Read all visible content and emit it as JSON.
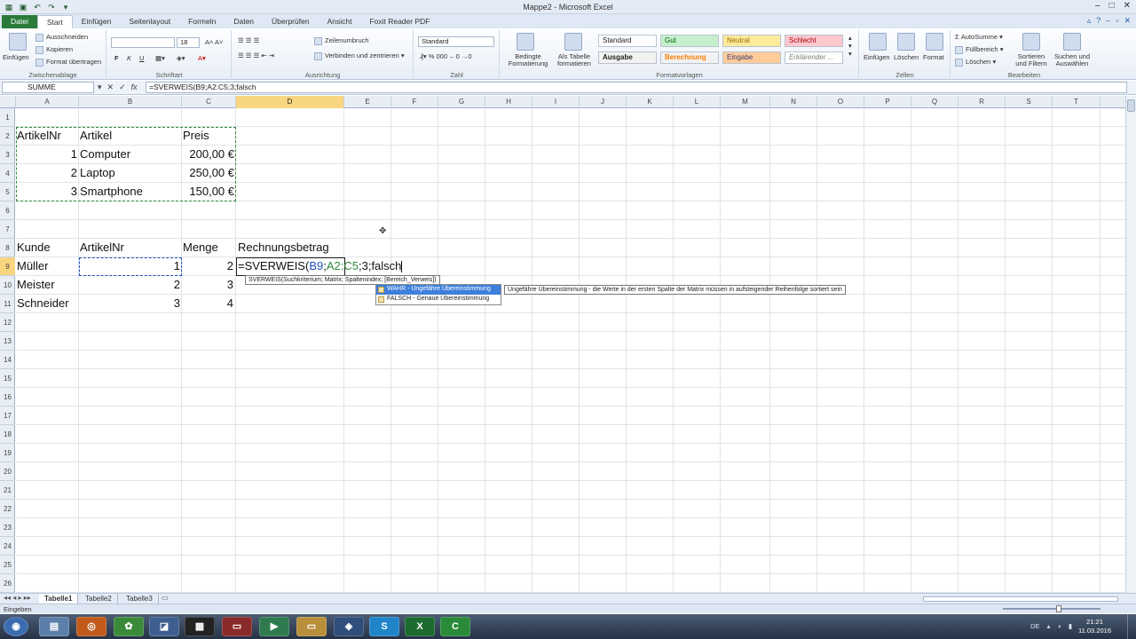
{
  "window": {
    "title": "Mappe2 - Microsoft Excel"
  },
  "tabs": [
    "Datei",
    "Start",
    "Einfügen",
    "Seitenlayout",
    "Formeln",
    "Daten",
    "Überprüfen",
    "Ansicht",
    "Foxit Reader PDF"
  ],
  "ribbon": {
    "clipboard": {
      "paste": "Einfügen",
      "cut": "Ausschneiden",
      "copy": "Kopieren",
      "format_painter": "Format übertragen",
      "title": "Zwischenablage"
    },
    "font": {
      "size": "18",
      "title": "Schriftart",
      "bold": "F",
      "italic": "K",
      "underline": "U"
    },
    "alignment": {
      "wrap": "Zeilenumbruch",
      "merge": "Verbinden und zentrieren",
      "title": "Ausrichtung"
    },
    "number": {
      "format": "Standard",
      "title": "Zahl"
    },
    "styles": {
      "cond_format": "Bedingte Formatierung",
      "as_table": "Als Tabelle formatieren",
      "boxes": [
        "Standard",
        "Gut",
        "Neutral",
        "Schlecht",
        "Ausgabe",
        "Berechnung",
        "Eingabe",
        "Erklärender ..."
      ],
      "title": "Formatvorlagen"
    },
    "cells": {
      "insert": "Einfügen",
      "delete": "Löschen",
      "format": "Format",
      "title": "Zellen"
    },
    "editing": {
      "autosum": "AutoSumme",
      "fill": "Füllbereich",
      "clear": "Löschen",
      "sort": "Sortieren und Filtern",
      "find": "Suchen und Auswählen",
      "title": "Bearbeiten"
    }
  },
  "formula_bar": {
    "name_box": "SUMME",
    "formula": "=SVERWEIS(B9;A2:C5;3;falsch"
  },
  "columns": [
    "A",
    "B",
    "C",
    "D",
    "E",
    "F",
    "G",
    "H",
    "I",
    "J",
    "K",
    "L",
    "M",
    "N",
    "O",
    "P",
    "Q",
    "R",
    "S",
    "T"
  ],
  "rows": [
    "1",
    "2",
    "3",
    "4",
    "5",
    "6",
    "7",
    "8",
    "9",
    "10",
    "11",
    "12",
    "13",
    "14",
    "15",
    "16",
    "17",
    "18",
    "19",
    "20",
    "21",
    "22",
    "23",
    "24",
    "25",
    "26"
  ],
  "cells": {
    "a2": "ArtikelNr",
    "b2": "Artikel",
    "c2": "Preis",
    "a3": "1",
    "b3": "Computer",
    "c3": "200,00 €",
    "a4": "2",
    "b4": "Laptop",
    "c4": "250,00 €",
    "a5": "3",
    "b5": "Smartphone",
    "c5": "150,00 €",
    "a8": "Kunde",
    "b8": "ArtikelNr",
    "c8": "Menge",
    "d8": "Rechnungsbetrag",
    "a9": "Müller",
    "b9": "1",
    "c9": "2",
    "a10": "Meister",
    "b10": "2",
    "c10": "3",
    "a11": "Schneider",
    "b11": "3",
    "c11": "4",
    "d9_prefix": "=SVERWEIS(",
    "d9_ref1": "B9",
    "d9_sep1": ";",
    "d9_ref2": "A2:C5",
    "d9_rest": ";3;falsch"
  },
  "autocomplete": {
    "syntax_tip": "SVERWEIS(Suchkriterium; Matrix; Spaltenindex; [Bereich_Verweis])",
    "items": [
      "WAHR - Ungefähre Übereinstimmung",
      "FALSCH - Genaue Übereinstimmung"
    ],
    "description": "Ungefähre Übereinstimmung - die Werte in der ersten Spalte der Matrix müssen in aufsteigender Reihenfolge sortiert sein"
  },
  "sheets": [
    "Tabelle1",
    "Tabelle2",
    "Tabelle3"
  ],
  "status": {
    "mode": "Eingeben"
  },
  "taskbar": {
    "lang": "DE",
    "time": "21:21",
    "date": "11.03.2016"
  },
  "colors": {
    "excel_green": "#2a7a3a",
    "selection": "#f8d680",
    "ref_blue": "#1f4fc1",
    "ref_green": "#2e8b3a"
  }
}
